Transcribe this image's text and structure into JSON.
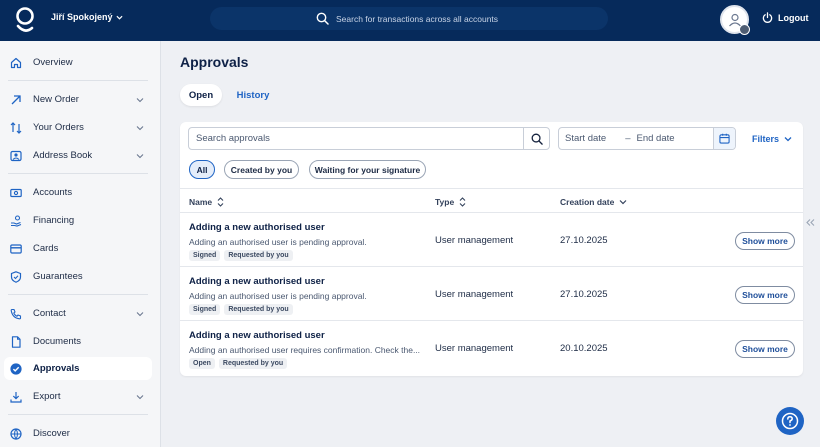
{
  "header": {
    "user_name": "Jiří Spokojený",
    "search_placeholder": "Search for transactions across all accounts",
    "logout_label": "Logout"
  },
  "sidebar": {
    "items": [
      {
        "label": "Overview",
        "icon": "home-icon"
      },
      {
        "label": "New Order",
        "icon": "arrow-up-right-icon",
        "has_chevron": true
      },
      {
        "label": "Your Orders",
        "icon": "transfer-icon",
        "has_chevron": true
      },
      {
        "label": "Address Book",
        "icon": "contact-card-icon",
        "has_chevron": true
      },
      {
        "label": "Accounts",
        "icon": "money-icon"
      },
      {
        "label": "Financing",
        "icon": "hand-coins-icon"
      },
      {
        "label": "Cards",
        "icon": "card-icon"
      },
      {
        "label": "Guarantees",
        "icon": "shield-icon"
      },
      {
        "label": "Contact",
        "icon": "phone-icon",
        "has_chevron": true
      },
      {
        "label": "Documents",
        "icon": "document-icon"
      },
      {
        "label": "Approvals",
        "icon": "check-circle-icon",
        "active": true
      },
      {
        "label": "Export",
        "icon": "download-icon",
        "has_chevron": true
      },
      {
        "label": "Discover",
        "icon": "globe-icon"
      }
    ]
  },
  "main": {
    "title": "Approvals",
    "tabs": [
      {
        "label": "Open",
        "active": true
      },
      {
        "label": "History",
        "active": false
      }
    ],
    "search_placeholder": "Search approvals",
    "start_date_placeholder": "Start date",
    "date_separator": "–",
    "end_date_placeholder": "End date",
    "filters_label": "Filters",
    "chips": [
      {
        "label": "All",
        "active": true
      },
      {
        "label": "Created by you",
        "active": false
      },
      {
        "label": "Waiting for your signature",
        "active": false
      }
    ],
    "columns": {
      "name": "Name",
      "type": "Type",
      "creation_date": "Creation date"
    },
    "rows": [
      {
        "title": "Adding a new authorised user",
        "description": "Adding an authorised user is pending approval.",
        "tags": [
          "Signed",
          "Requested by you"
        ],
        "type": "User management",
        "date": "27.10.2025",
        "action": "Show more"
      },
      {
        "title": "Adding a new authorised user",
        "description": "Adding an authorised user is pending approval.",
        "tags": [
          "Signed",
          "Requested by you"
        ],
        "type": "User management",
        "date": "27.10.2025",
        "action": "Show more"
      },
      {
        "title": "Adding a new authorised user",
        "description": "Adding an authorised user requires confirmation. Check the...",
        "tags": [
          "Open",
          "Requested by you"
        ],
        "type": "User management",
        "date": "20.10.2025",
        "action": "Show more"
      }
    ]
  },
  "colors": {
    "header_bg": "#062a5b",
    "accent": "#1f64c4",
    "page_bg": "#eef0f4"
  }
}
